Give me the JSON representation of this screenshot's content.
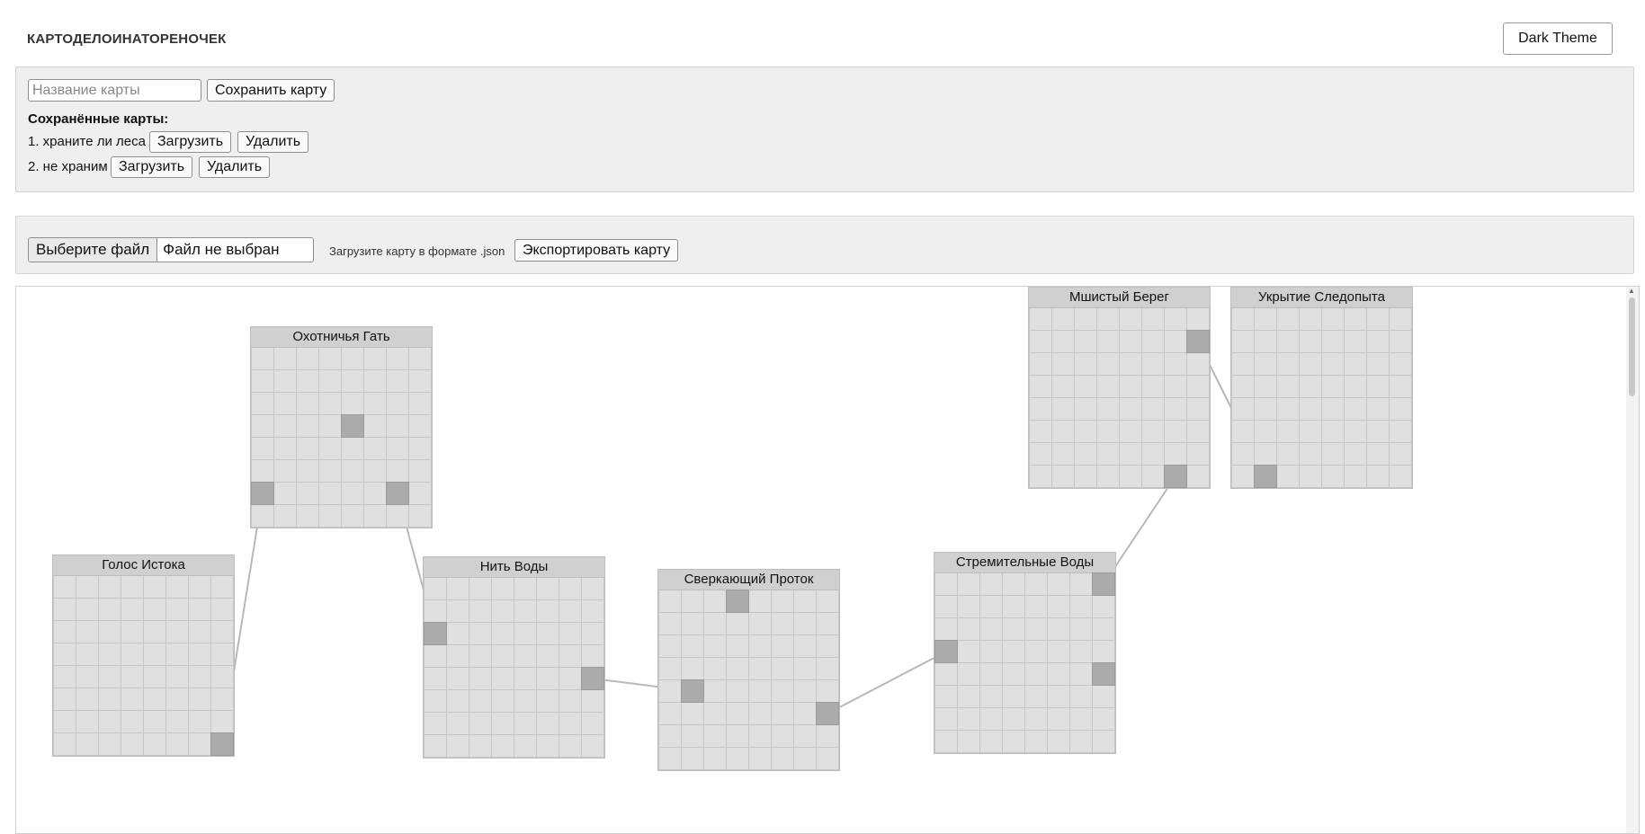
{
  "app": {
    "title": "КАРТОДЕЛОИНАТОРЕНОЧЕК",
    "theme_button": "Dark Theme"
  },
  "save_panel": {
    "name_placeholder": "Название карты",
    "save_button": "Сохранить карту",
    "saved_heading": "Сохранённые карты:",
    "saved_maps": [
      {
        "label": "1. храните ли леса",
        "load": "Загрузить",
        "delete": "Удалить"
      },
      {
        "label": "2. не храним",
        "load": "Загрузить",
        "delete": "Удалить"
      }
    ]
  },
  "file_panel": {
    "choose_file": "Выберите файл",
    "no_file": "Файл не выбран",
    "hint": "Загрузите карту в формате .json",
    "export_button": "Экспортировать карту"
  },
  "colors": {
    "room_bg": "#e0e0e0",
    "exit_cell": "#ababab",
    "link_line": "#b8b8b8"
  },
  "rooms": [
    {
      "id": "r1",
      "title": "Охотничья Гать",
      "exits": [
        [
          3,
          4
        ],
        [
          6,
          0
        ],
        [
          6,
          6
        ]
      ]
    },
    {
      "id": "r2",
      "title": "Голос Истока",
      "exits": [
        [
          7,
          7
        ]
      ]
    },
    {
      "id": "r3",
      "title": "Нить Воды",
      "exits": [
        [
          2,
          0
        ],
        [
          4,
          7
        ]
      ]
    },
    {
      "id": "r4",
      "title": "Сверкающий Проток",
      "exits": [
        [
          0,
          3
        ],
        [
          4,
          1
        ],
        [
          5,
          7
        ]
      ]
    },
    {
      "id": "r5",
      "title": "Стремительные Воды",
      "exits": [
        [
          0,
          7
        ],
        [
          3,
          0
        ],
        [
          4,
          7
        ]
      ]
    },
    {
      "id": "r6",
      "title": "Мшистый Берег",
      "exits": [
        [
          1,
          7
        ],
        [
          7,
          6
        ]
      ]
    },
    {
      "id": "r7",
      "title": "Укрытие Следопыта",
      "exits": [
        [
          7,
          1
        ]
      ]
    }
  ],
  "links": [
    {
      "from": [
        "r1",
        6,
        0
      ],
      "to": [
        "r2",
        7,
        7
      ]
    },
    {
      "from": [
        "r1",
        6,
        6
      ],
      "to": [
        "r3",
        2,
        0
      ]
    },
    {
      "from": [
        "r3",
        4,
        7
      ],
      "to": [
        "r4",
        4,
        1
      ]
    },
    {
      "from": [
        "r4",
        5,
        7
      ],
      "to": [
        "r5",
        3,
        0
      ]
    },
    {
      "from": [
        "r5",
        0,
        7
      ],
      "to": [
        "r6",
        7,
        6
      ]
    },
    {
      "from": [
        "r6",
        1,
        7
      ],
      "to": [
        "r7",
        7,
        1
      ]
    }
  ]
}
